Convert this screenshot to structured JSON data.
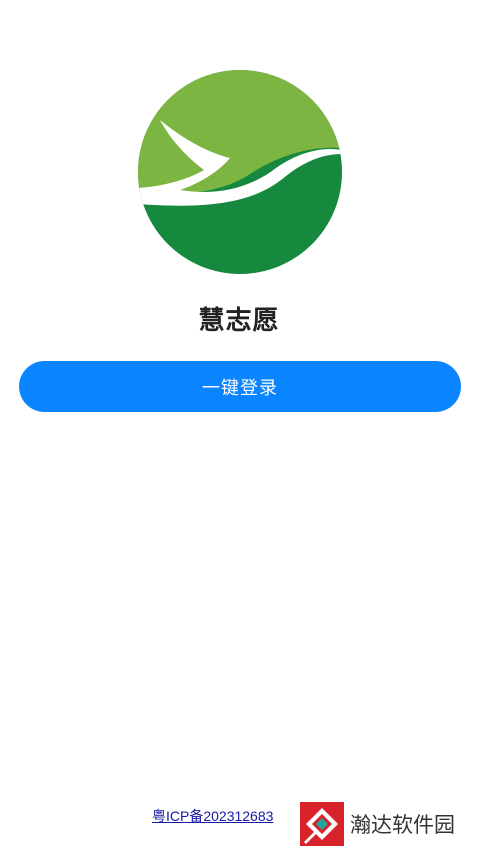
{
  "app": {
    "name": "慧志愿"
  },
  "login": {
    "button_label": "一键登录"
  },
  "footer": {
    "icp_text": "粤ICP备202312683",
    "watermark_text": "瀚达软件园"
  },
  "colors": {
    "primary_button": "#0a84ff",
    "logo_light_green": "#7cb542",
    "logo_dark_green": "#17893f",
    "link": "#1a1aa6",
    "watermark_red": "#d8232a",
    "watermark_teal": "#1fa59b"
  },
  "icons": {
    "logo": "green-bird-circle-logo",
    "watermark": "handa-watermark-icon"
  }
}
